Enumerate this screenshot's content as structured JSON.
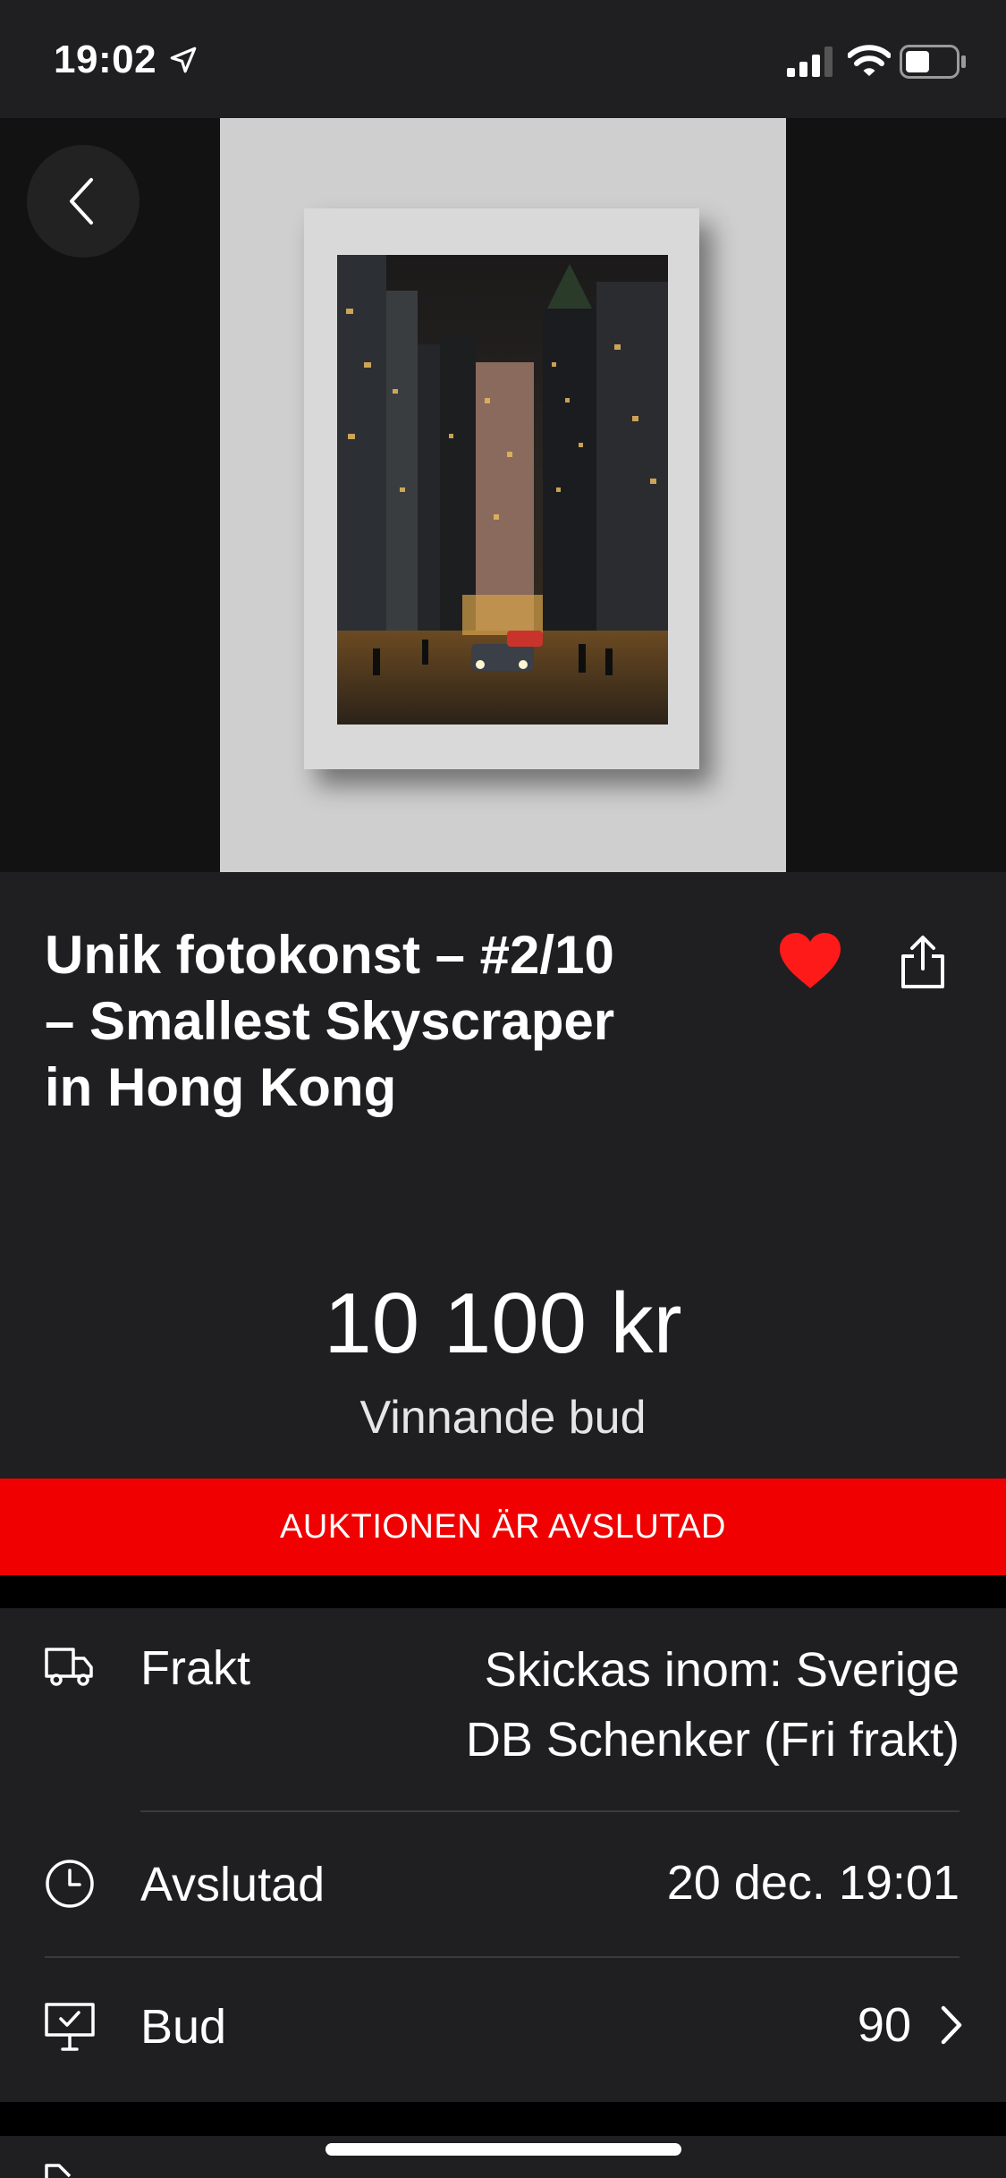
{
  "status_bar": {
    "time": "19:02",
    "icons": [
      "location-arrow-icon",
      "cellular-signal-icon",
      "wifi-icon",
      "battery-icon"
    ]
  },
  "hero": {
    "back_icon": "chevron-left-icon"
  },
  "listing": {
    "title": "Unik fotokonst – #2/10 – Smallest Skyscraper in Hong Kong",
    "favorite_icon": "heart-icon",
    "share_icon": "share-icon",
    "price": "10 100 kr",
    "price_label": "Vinnande bud"
  },
  "banner": {
    "text": "AUKTIONEN ÄR AVSLUTAD",
    "color": "#f00000"
  },
  "details": {
    "shipping": {
      "icon": "truck-icon",
      "label": "Frakt",
      "value_line1": "Skickas inom: Sverige",
      "value_line2": "DB Schenker (Fri frakt)"
    },
    "ended": {
      "icon": "clock-icon",
      "label": "Avslutad",
      "value": "20 dec. 19:01"
    },
    "bids": {
      "icon": "bid-sign-icon",
      "label": "Bud",
      "value": "90",
      "chevron_icon": "chevron-right-icon"
    }
  },
  "colors": {
    "background": "#1f1f21",
    "accent_red": "#f00000",
    "heart": "#ff1a1a"
  }
}
